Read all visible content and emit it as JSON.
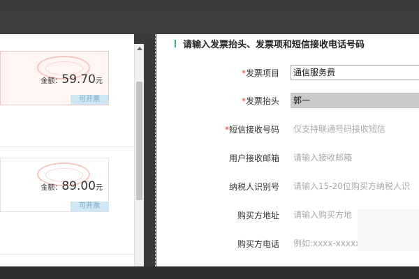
{
  "cards": [
    {
      "amount_label": "金额：",
      "amount": "59.70",
      "unit": "元",
      "badge": "可开票"
    },
    {
      "amount_label": "金额：",
      "amount": "89.00",
      "unit": "元",
      "badge": "可开票"
    }
  ],
  "form": {
    "title": "请输入发票抬头、发票项和短信接收电话号码",
    "rows": [
      {
        "label": "发票项目",
        "required": true,
        "value": "通信服务费",
        "placeholder": ""
      },
      {
        "label": "发票抬头",
        "required": true,
        "value": "郭一",
        "placeholder": ""
      },
      {
        "label": "短信接收号码",
        "required": true,
        "value": "",
        "placeholder": "仅支持联通号码接收短信"
      },
      {
        "label": "用户接收邮箱",
        "required": false,
        "value": "",
        "placeholder": "请输入接收邮箱"
      },
      {
        "label": "纳税人识别号",
        "required": false,
        "value": "",
        "placeholder": "请输入15-20位购买方纳税人识"
      },
      {
        "label": "购买方地址",
        "required": false,
        "value": "",
        "placeholder": "请输入购买方地"
      },
      {
        "label": "购买方电话",
        "required": false,
        "value": "",
        "placeholder": "例如:xxxx-xxxxxxx"
      }
    ],
    "required_mark": "*"
  },
  "colors": {
    "accent": "#2aa38f",
    "required": "#e03a2f",
    "badge_bg": "#cfe7f5"
  },
  "icons": {
    "scroll_up": "scroll-up-arrow-icon",
    "stamp": "stamp-icon"
  }
}
